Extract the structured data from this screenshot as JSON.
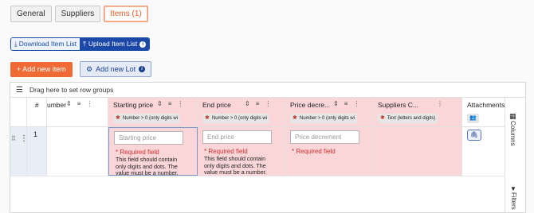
{
  "tabs": [
    {
      "label": "General",
      "active": false
    },
    {
      "label": "Suppliers",
      "active": false
    },
    {
      "label": "Items (1)",
      "active": true
    }
  ],
  "toolbar": {
    "download_label": "Download Item List",
    "upload_label": "Upload Item List",
    "add_item_label": "+ Add new item",
    "add_lot_label": "Add new Lot"
  },
  "grid": {
    "group_bar_text": "Drag here to set row groups",
    "row_number_header": "#",
    "columns": [
      {
        "title": "Number",
        "display_title": "umber",
        "chip": ""
      },
      {
        "title": "Starting price",
        "chip": "Number > 0 (only digits wi"
      },
      {
        "title": "End price",
        "chip": "Number > 0 (only digits wi"
      },
      {
        "title": "Price decrement",
        "display_title": "Price decre...",
        "chip": "Number > 0 (only digits wi"
      },
      {
        "title": "Suppliers C...",
        "chip": "Text (letters and digits)"
      },
      {
        "title": "Attachments",
        "chip": ""
      }
    ],
    "row": {
      "number": "1",
      "starting_price_placeholder": "Starting price",
      "end_price_placeholder": "End price",
      "price_decrement_placeholder": "Price decrement",
      "required": "* Required field",
      "message": "This field should contain only digits and dots. The value must be a number."
    },
    "side_panel": {
      "columns": "Columns",
      "filters": "Filters"
    }
  }
}
